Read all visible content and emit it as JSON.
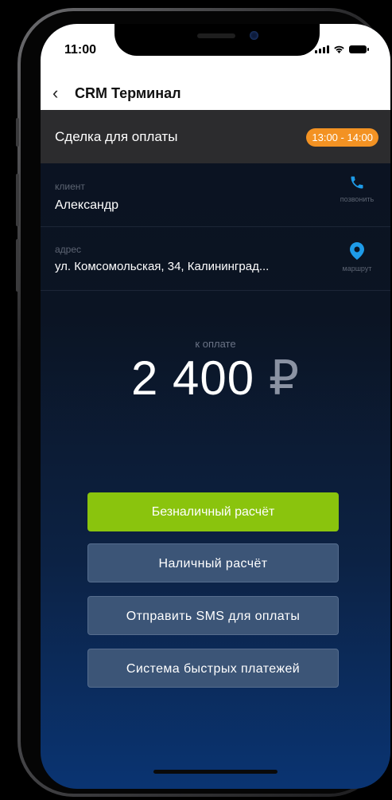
{
  "status_bar": {
    "time": "11:00"
  },
  "nav": {
    "back_icon": "chevron-left-icon",
    "title": "CRM Терминал"
  },
  "deal": {
    "title": "Сделка для оплаты",
    "time_slot": "13:00 - 14:00"
  },
  "client": {
    "label": "клиент",
    "name": "Александр",
    "action_icon": "phone-icon",
    "action_label": "позвонить"
  },
  "address": {
    "label": "адрес",
    "value": "ул. Комсомольская, 34, Калининград...",
    "action_icon": "map-pin-icon",
    "action_label": "маршрут"
  },
  "payment": {
    "label": "к оплате",
    "amount": "2 400",
    "currency": "₽"
  },
  "buttons": {
    "cashless": "Безналичный расчёт",
    "cash": "Наличный расчёт",
    "sms": "Отправить SMS для оплаты",
    "sbp": "Система быстрых платежей"
  },
  "colors": {
    "accent_green": "#8ac40d",
    "badge_orange": "#f39223",
    "icon_blue": "#1e9be8",
    "button_blue": "#3c5577"
  }
}
